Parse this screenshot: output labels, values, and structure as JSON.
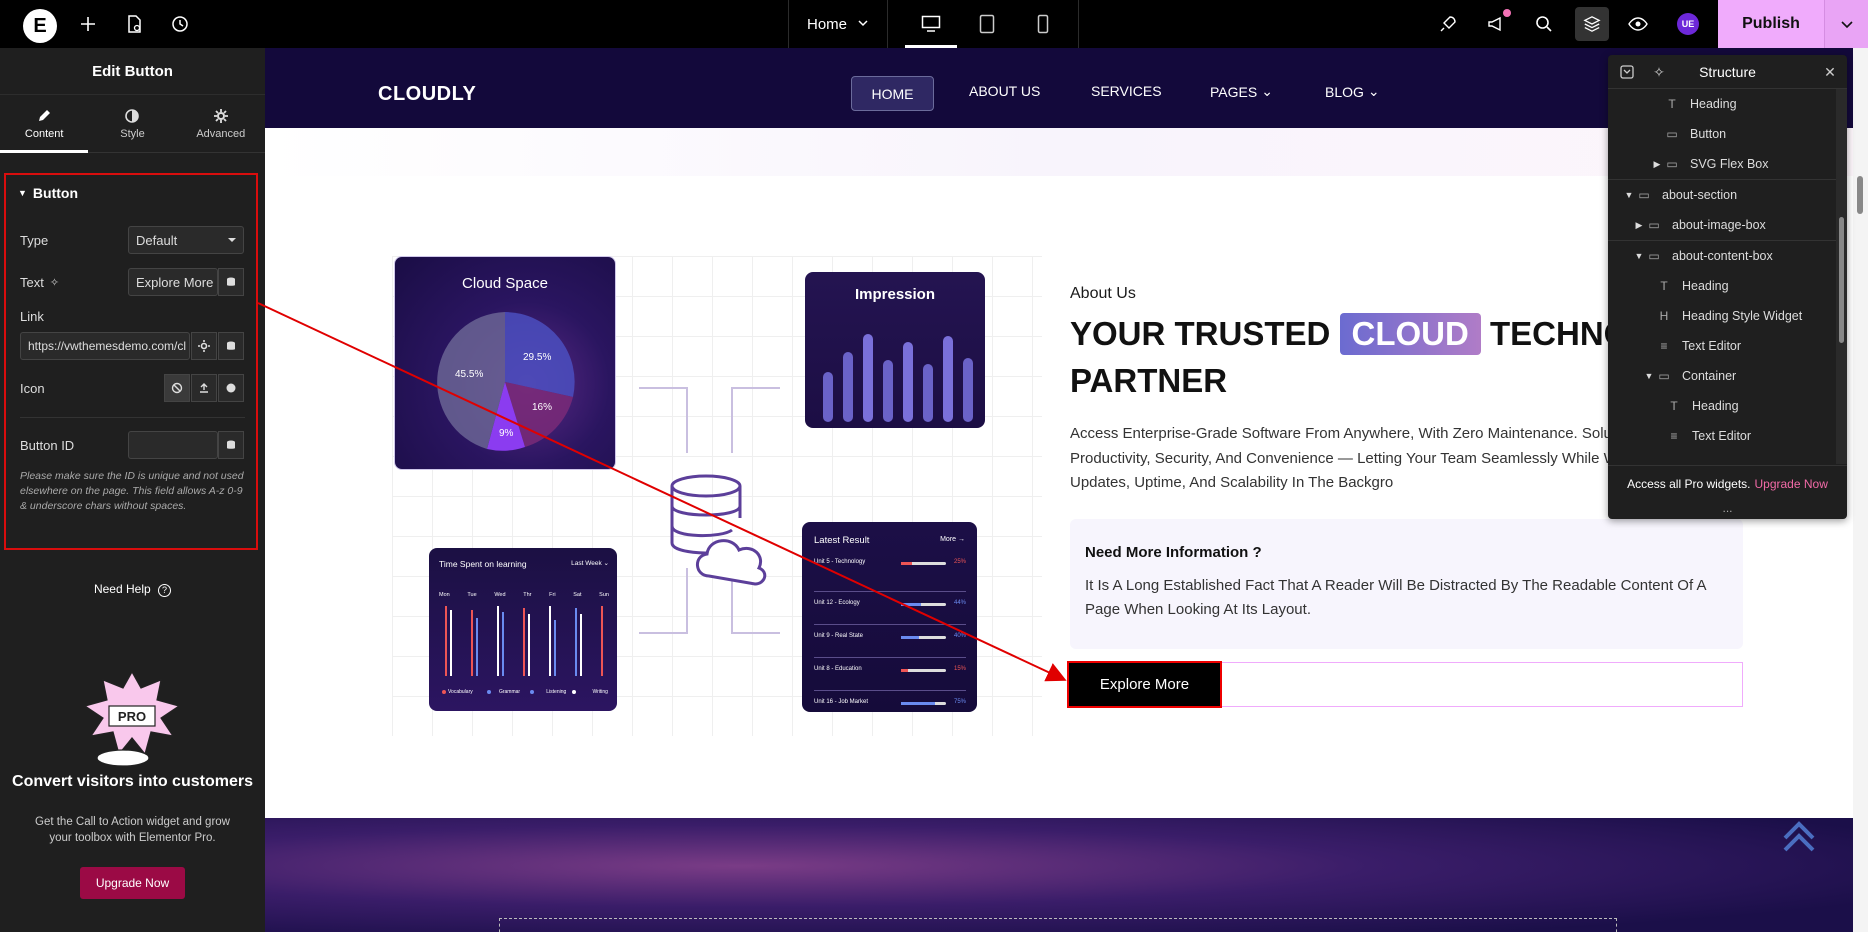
{
  "topbar": {
    "logo_letter": "E",
    "page_name": "Home",
    "publish_label": "Publish",
    "user_badge": "UE"
  },
  "panel": {
    "title": "Edit Button",
    "tabs": [
      {
        "label": "Content",
        "icon": "pencil-icon"
      },
      {
        "label": "Style",
        "icon": "half-circle-icon"
      },
      {
        "label": "Advanced",
        "icon": "gear-icon"
      }
    ],
    "section_title": "Button",
    "type_label": "Type",
    "type_value": "Default",
    "text_label": "Text",
    "text_value": "Explore More",
    "link_label": "Link",
    "link_value": "https://vwthemesdemo.com/cl",
    "icon_label": "Icon",
    "button_id_label": "Button ID",
    "button_id_value": "",
    "note": "Please make sure the ID is unique and not used elsewhere on the page. This field allows A-z 0-9 & underscore chars without spaces.",
    "need_help": "Need Help",
    "promo_badge": "PRO",
    "promo_title": "Convert visitors into customers",
    "promo_text": "Get the Call to Action widget and grow your toolbox with Elementor Pro.",
    "upgrade_label": "Upgrade Now"
  },
  "site": {
    "brand": "CLOUDLY",
    "nav": [
      "HOME",
      "ABOUT US",
      "SERVICES",
      "PAGES",
      "BLOG"
    ],
    "cards": {
      "cloud_title": "Cloud Space",
      "pie_labels": [
        "45.5%",
        "29.5%",
        "16%",
        "9%"
      ],
      "impression_title": "Impression",
      "time_title": "Time Spent on learning",
      "time_filter": "Last Week",
      "days": [
        "Mon",
        "Tue",
        "Wed",
        "Thr",
        "Fri",
        "Sat",
        "Sun"
      ],
      "time_legend": [
        "Vocabulary",
        "Grammar",
        "Listening",
        "Writing"
      ],
      "latest_title": "Latest Result",
      "latest_more": "More",
      "latest_rows": [
        {
          "label": "Unit 5 - Technology",
          "pct": "25%"
        },
        {
          "label": "Unit 12 - Ecology",
          "pct": "44%"
        },
        {
          "label": "Unit 9 - Real State",
          "pct": "40%"
        },
        {
          "label": "Unit 8 - Education",
          "pct": "15%"
        },
        {
          "label": "Unit 16 - Job Market",
          "pct": "75%"
        }
      ]
    },
    "about_label": "About Us",
    "headline_pre": "YOUR TRUSTED ",
    "headline_highlight": "CLOUD",
    "headline_post": " TECHNOL",
    "headline_line2": "PARTNER",
    "paragraph": "Access Enterprise-Grade Software From Anywhere, With Zero Maintenance. Solutions Deliver Productivity, Security, And Convenience — Letting Your Team Seamlessly While We Handle Updates, Uptime, And Scalability In The Backgro",
    "info_title": "Need More Information ?",
    "info_text": "It Is A Long Established Fact That A Reader Will Be Distracted By The Readable Content Of A Page When Looking At Its Layout.",
    "button_label": "Explore More"
  },
  "structure": {
    "title": "Structure",
    "rows": [
      {
        "label": "Heading",
        "icon": "heading-icon",
        "caret": ""
      },
      {
        "label": "Button",
        "icon": "button-icon",
        "caret": ""
      },
      {
        "label": "SVG Flex Box",
        "icon": "flexbox-icon",
        "caret": "right"
      },
      {
        "label": "about-section",
        "icon": "container-icon",
        "caret": "down"
      },
      {
        "label": "about-image-box",
        "icon": "container-icon",
        "caret": "right"
      },
      {
        "label": "about-content-box",
        "icon": "container-icon",
        "caret": "down"
      },
      {
        "label": "Heading",
        "icon": "heading-icon",
        "caret": ""
      },
      {
        "label": "Heading Style Widget",
        "icon": "heading-style-icon",
        "caret": ""
      },
      {
        "label": "Text Editor",
        "icon": "text-editor-icon",
        "caret": ""
      },
      {
        "label": "Container",
        "icon": "container-icon",
        "caret": "down"
      },
      {
        "label": "Heading",
        "icon": "heading-icon",
        "caret": ""
      },
      {
        "label": "Text Editor",
        "icon": "text-editor-icon",
        "caret": ""
      }
    ],
    "footer_text": "Access all Pro widgets.",
    "footer_link": "Upgrade Now",
    "more": "..."
  },
  "colors": {
    "accent_pink": "#f0abfc",
    "nav_bg": "#13093b",
    "annotation_red": "#e00000",
    "upgrade_bg": "#9b0a45"
  }
}
